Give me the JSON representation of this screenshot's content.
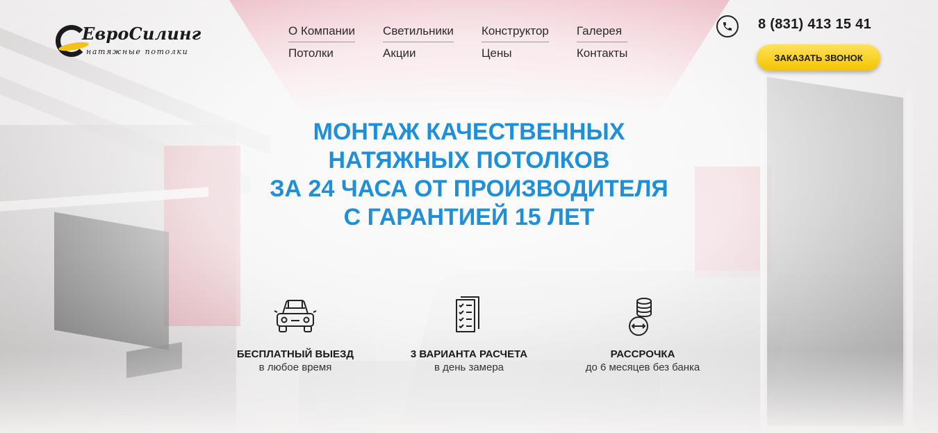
{
  "brand": {
    "name": "ЕвроСилинг",
    "tagline": "натяжные потолки"
  },
  "nav": {
    "columns": [
      {
        "top": "О Компании",
        "bottom": "Потолки"
      },
      {
        "top": "Светильники",
        "bottom": "Акции"
      },
      {
        "top": "Конструктор",
        "bottom": "Цены"
      },
      {
        "top": "Галерея",
        "bottom": "Контакты"
      }
    ]
  },
  "contact": {
    "phone": "8 (831) 413 15 41",
    "call_button": "Заказать звонок",
    "phone_icon": "phone-icon"
  },
  "hero": {
    "headline": [
      "Монтаж качественных",
      "натяжных потолков",
      "за 24 часа от производителя",
      "с гарантией 15 лет"
    ]
  },
  "features": [
    {
      "icon": "car-icon",
      "title": "Бесплатный выезд",
      "subtitle": "в любое время"
    },
    {
      "icon": "checklist-icon",
      "title": "3 варианта расчета",
      "subtitle": "в день замера"
    },
    {
      "icon": "coins-icon",
      "title": "Рассрочка",
      "subtitle": "до 6 месяцев без банка"
    }
  ],
  "colors": {
    "accent_blue": "#1f8fd8",
    "button_yellow": "#f5c400",
    "text_dark": "#1a1a1a"
  }
}
